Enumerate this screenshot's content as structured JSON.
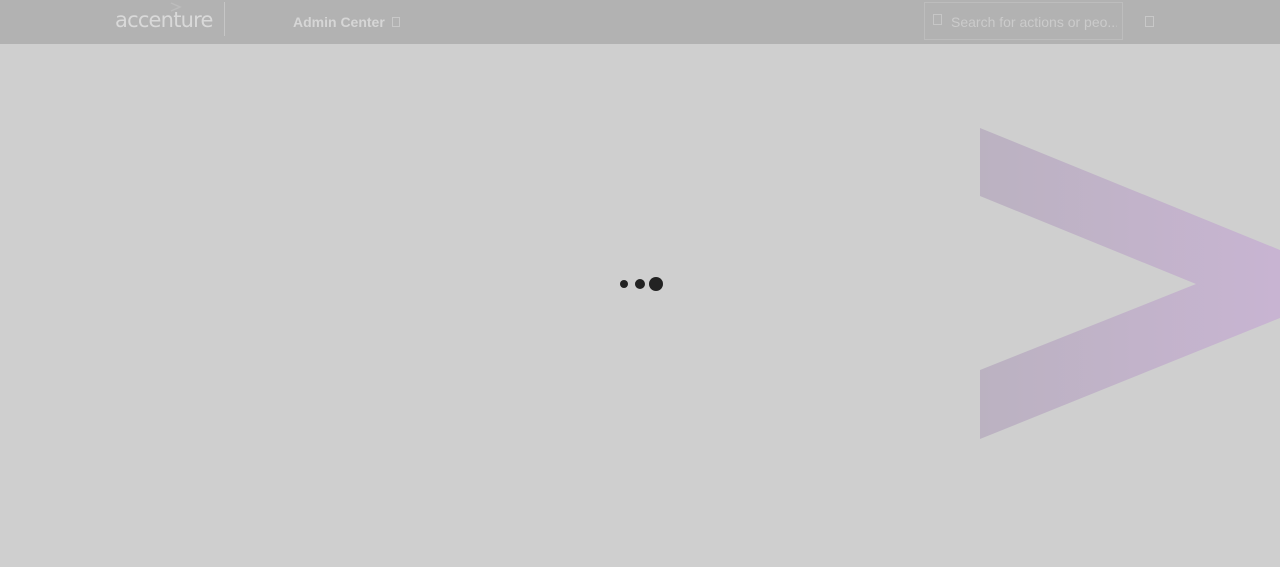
{
  "header": {
    "logo_text": "accenture",
    "module_label": "Admin Center",
    "search": {
      "placeholder": "Search for actions or peo...",
      "value": ""
    }
  },
  "icons": {
    "logo_mark": "accenture-arrow-mark",
    "module_chevron": "chevron-down-icon",
    "search": "search-icon",
    "header_action": "notification-icon",
    "loader": "loading-dots-icon",
    "decorative": "accenture-greater-than-chevron"
  },
  "colors": {
    "overlay_background": "#cfcfcf",
    "header_background": "#b2b2b2",
    "loader_dots": "#222222",
    "chevron_gradient_start": "#bbb2c1",
    "chevron_gradient_end": "#c8b4d2"
  }
}
